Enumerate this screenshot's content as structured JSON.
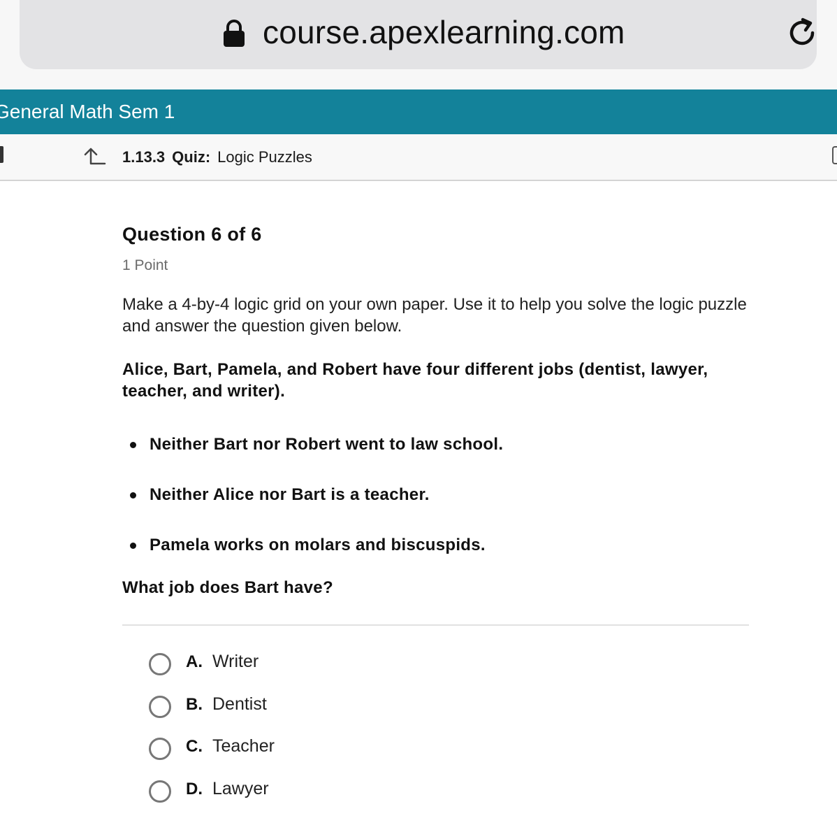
{
  "browser": {
    "url": "course.apexlearning.com",
    "icons": {
      "lock": "lock-icon",
      "reload": "reload-icon"
    }
  },
  "banner": {
    "course_title": "General Math Sem 1",
    "color": "#13829a"
  },
  "subnav": {
    "section_number": "1.13.3",
    "activity_type": "Quiz:",
    "activity_title": "Logic Puzzles",
    "icons": {
      "up": "up-arrow-icon"
    }
  },
  "question": {
    "heading": "Question 6 of 6",
    "points": "1 Point",
    "intro": "Make a 4-by-4 logic grid on your own paper. Use it to help you solve the logic puzzle and answer the question given below.",
    "puzzle": "Alice, Bart, Pamela, and Robert have four different jobs (dentist, lawyer, teacher, and writer).",
    "clues": [
      "Neither Bart nor Robert went to law school.",
      "Neither Alice nor Bart is a teacher.",
      "Pamela works on molars and biscuspids."
    ],
    "prompt": "What job does Bart have?"
  },
  "options": [
    {
      "letter": "A.",
      "text": "Writer",
      "selected": false
    },
    {
      "letter": "B.",
      "text": "Dentist",
      "selected": false
    },
    {
      "letter": "C.",
      "text": "Teacher",
      "selected": false
    },
    {
      "letter": "D.",
      "text": "Lawyer",
      "selected": false
    }
  ]
}
